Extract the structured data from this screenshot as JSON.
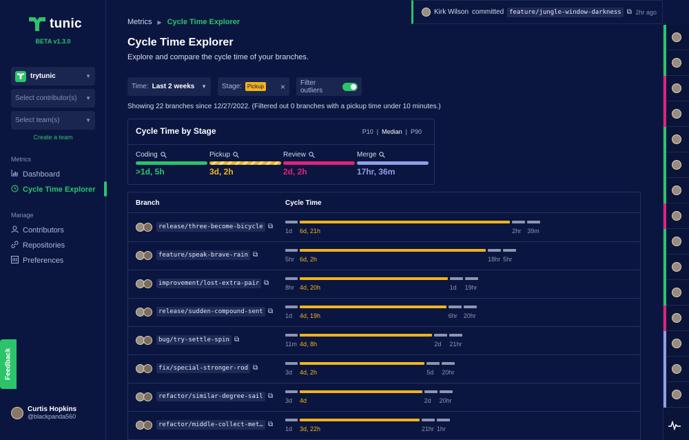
{
  "app": {
    "name": "tunic",
    "version": "BETA v1.3.0"
  },
  "sidebar": {
    "workspace": "trytunic",
    "contributors_placeholder": "Select contributor(s)",
    "teams_placeholder": "Select team(s)",
    "create_team": "Create a team",
    "metrics_section": "Metrics",
    "dashboard": "Dashboard",
    "cycle_time_explorer": "Cycle Time Explorer",
    "manage_section": "Manage",
    "contributors": "Contributors",
    "repositories": "Repositories",
    "preferences": "Preferences",
    "feedback": "Feedback",
    "user": {
      "name": "Curtis Hopkins",
      "handle": "@blackpanda560"
    }
  },
  "breadcrumb": {
    "parent": "Metrics",
    "current": "Cycle Time Explorer"
  },
  "page": {
    "title": "Cycle Time Explorer",
    "subtitle": "Explore and compare the cycle time of your branches."
  },
  "filters": {
    "time_label": "Time:",
    "time_value": "Last 2 weeks",
    "stage_label": "Stage:",
    "stage_value": "Pickup",
    "outliers_label": "Filter outliers",
    "outliers_on": true
  },
  "showing": "Showing 22 branches since 12/27/2022. (Filtered out 0 branches with a pickup time under 10 minutes.)",
  "stage_card": {
    "title": "Cycle Time by Stage",
    "p10": "P10",
    "median": "Median",
    "p90": "P90",
    "stages": [
      {
        "name": "Coding",
        "value": ">1d, 5h",
        "color": "#2bc46b"
      },
      {
        "name": "Pickup",
        "value": "3d, 2h",
        "color": "#f2b31b"
      },
      {
        "name": "Review",
        "value": "2d, 2h",
        "color": "#e0237a"
      },
      {
        "name": "Merge",
        "value": "17hr, 36m",
        "color": "#8f9fe6"
      }
    ]
  },
  "table": {
    "col_branch": "Branch",
    "col_cycle": "Cycle Time",
    "rows": [
      {
        "branch": "release/three-become-bicycle",
        "coding": "1d",
        "pickup": "6d, 21h",
        "review": "2hr",
        "merge": "39m"
      },
      {
        "branch": "feature/speak-brave-rain",
        "coding": "5hr",
        "pickup": "6d, 2h",
        "review": "18hr",
        "merge": "5hr"
      },
      {
        "branch": "improvement/lost-extra-pair",
        "coding": "8hr",
        "pickup": "4d, 20h",
        "review": "1d",
        "merge": "19hr"
      },
      {
        "branch": "release/sudden-compound-sent",
        "coding": "1d",
        "pickup": "4d, 19h",
        "review": "6hr",
        "merge": "20hr"
      },
      {
        "branch": "bug/try-settle-spin",
        "coding": "11m",
        "pickup": "4d, 8h",
        "review": "2d",
        "merge": "21hr"
      },
      {
        "branch": "fix/special-stronger-rod",
        "coding": "3d",
        "pickup": "4d, 2h",
        "review": "5d",
        "merge": "20hr"
      },
      {
        "branch": "refactor/similar-degree-sail",
        "coding": "3d",
        "pickup": "4d",
        "review": "2d",
        "merge": "20hr"
      },
      {
        "branch": "refactor/middle-collect-met…",
        "coding": "1d",
        "pickup": "3d, 22h",
        "review": "21hr",
        "merge": "1hr"
      }
    ]
  },
  "notification": {
    "who": "Kirk Wilson",
    "action": "committed",
    "ref": "feature/jungle-window-darkness",
    "time": "2hr ago"
  },
  "rail_colors": [
    "#2bc46b",
    "#2bc46b",
    "#e0237a",
    "#e0237a",
    "#2bc46b",
    "#2bc46b",
    "#2bc46b",
    "#e0237a",
    "#2bc46b",
    "#2bc46b",
    "#2bc46b",
    "#e0237a",
    "#8f9fe6",
    "#8f9fe6",
    "#8f9fe6"
  ]
}
